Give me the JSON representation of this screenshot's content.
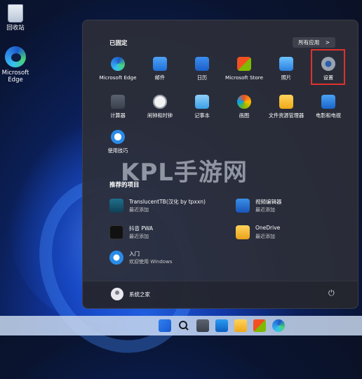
{
  "desktop": {
    "icons": [
      {
        "label": "回收站",
        "icon": "recycle-bin-icon"
      },
      {
        "label": "Microsoft\nEdge",
        "icon": "edge-icon"
      }
    ]
  },
  "start_menu": {
    "pinned_title": "已固定",
    "all_apps_label": "所有应用",
    "all_apps_chevron": ">",
    "pinned": [
      {
        "label": "Microsoft Edge",
        "icon": "edge-icon"
      },
      {
        "label": "邮件",
        "icon": "mail-icon"
      },
      {
        "label": "日历",
        "icon": "calendar-icon"
      },
      {
        "label": "Microsoft Store",
        "icon": "store-icon"
      },
      {
        "label": "照片",
        "icon": "photos-icon"
      },
      {
        "label": "设置",
        "icon": "settings-gear-icon"
      },
      {
        "label": "计算器",
        "icon": "calculator-icon"
      },
      {
        "label": "闹钟和时钟",
        "icon": "alarm-clock-icon"
      },
      {
        "label": "记事本",
        "icon": "notepad-icon"
      },
      {
        "label": "画图",
        "icon": "paint-icon"
      },
      {
        "label": "文件资源管理器",
        "icon": "file-explorer-icon"
      },
      {
        "label": "电影和电视",
        "icon": "movies-tv-icon"
      },
      {
        "label": "使用技巧",
        "icon": "tips-icon"
      }
    ],
    "recommended_title": "推荐的项目",
    "recommended": [
      {
        "title": "TranslucentTB(汉化 by tpxxn)",
        "subtitle": "最近添加",
        "icon": "translucenttb-icon"
      },
      {
        "title": "视频编辑器",
        "subtitle": "最近添加",
        "icon": "video-editor-icon"
      },
      {
        "title": "抖音 PWA",
        "subtitle": "最近添加",
        "icon": "douyin-icon"
      },
      {
        "title": "OneDrive",
        "subtitle": "最近添加",
        "icon": "onedrive-icon"
      },
      {
        "title": "入门",
        "subtitle": "欢迎使用 Windows",
        "icon": "get-started-icon"
      }
    ],
    "user_name": "系统之家",
    "power_icon": "power-icon"
  },
  "watermark": "KPL手游网",
  "taskbar": {
    "icons": [
      "start-icon",
      "search-icon",
      "task-view-icon",
      "widgets-icon",
      "file-explorer-icon",
      "store-icon",
      "edge-icon"
    ]
  },
  "colors": {
    "highlight": "#e0312b",
    "accent": "#1f5fe0"
  }
}
